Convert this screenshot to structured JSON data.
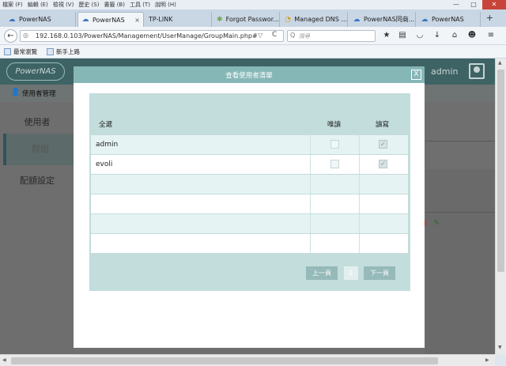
{
  "menubar": {
    "items": [
      "檔案 (F)",
      "編輯 (E)",
      "檢視 (V)",
      "歷史 (S)",
      "書籤 (B)",
      "工具 (T)",
      "說明 (H)"
    ],
    "minimize": "—",
    "maximize": "□",
    "close": "✕"
  },
  "tabs": [
    {
      "title": "PowerNAS",
      "icon": "cloud-icon",
      "active": false
    },
    {
      "title": "PowerNAS",
      "icon": "cloud-icon",
      "active": true
    },
    {
      "title": "TP-LINK",
      "icon": "",
      "active": false
    },
    {
      "title": "Forgot Passwor...",
      "icon": "settings-icon",
      "active": false
    },
    {
      "title": "Managed DNS ...",
      "icon": "loading-icon",
      "active": false
    },
    {
      "title": "PowerNAS同商...",
      "icon": "cloud-icon",
      "active": false
    },
    {
      "title": "PowerNAS",
      "icon": "cloud-icon",
      "active": false
    }
  ],
  "tab_close": "×",
  "new_tab": "+",
  "navbar": {
    "url": "192.168.0.103/PowerNAS/Management/UserManage/GroupMain.php#",
    "search_placeholder": "搜尋",
    "back": "←",
    "dropdown": "▽",
    "reload": "C",
    "search_glyph": "Q",
    "star": "★",
    "bookmark_list": "▤",
    "pocket": "◡",
    "download": "↓",
    "home": "⌂",
    "chat": "☻",
    "menu": "≡"
  },
  "bookmarks": [
    {
      "label": "最常瀏覽"
    },
    {
      "label": "新手上路"
    }
  ],
  "app": {
    "logo": "PowerNAS",
    "user": "admin",
    "section_title": "使用者管理",
    "sidebar": [
      {
        "label": "使用者",
        "selected": false
      },
      {
        "label": "群組",
        "selected": true
      },
      {
        "label": "配額設定",
        "selected": false
      }
    ]
  },
  "modal": {
    "title": "查看使用者清單",
    "close": "X",
    "columns": {
      "name": "全選",
      "readonly": "唯讀",
      "readwrite": "讀寫"
    },
    "rows": [
      {
        "name": "admin",
        "readonly": false,
        "readwrite": true
      },
      {
        "name": "evoli",
        "readonly": false,
        "readwrite": true
      },
      {
        "name": "",
        "readonly": null,
        "readwrite": null
      },
      {
        "name": "",
        "readonly": null,
        "readwrite": null
      },
      {
        "name": "",
        "readonly": null,
        "readwrite": null
      },
      {
        "name": "",
        "readonly": null,
        "readwrite": null
      }
    ],
    "check_glyph": "✓",
    "pagination": {
      "prev": "上一頁",
      "current": "1",
      "next": "下一頁"
    }
  },
  "colors": {
    "modal_header": "#86b7b7",
    "panel": "#c3dcdc",
    "page_topbar": "#3e6365",
    "pager_button": "#96b9b9"
  }
}
